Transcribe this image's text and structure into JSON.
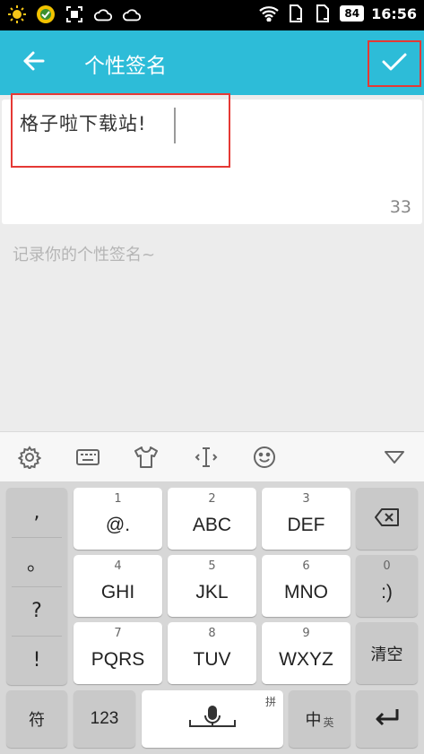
{
  "status_bar": {
    "battery": "84",
    "time": "16:56"
  },
  "header": {
    "title": "个性签名"
  },
  "editor": {
    "text": "格子啦下载站!",
    "counter": "33",
    "hint": "记录你的个性签名~"
  },
  "keyboard": {
    "punct": [
      ",",
      "。",
      "?",
      "!"
    ],
    "keys": {
      "k1": {
        "num": "1",
        "label": "@."
      },
      "k2": {
        "num": "2",
        "label": "ABC"
      },
      "k3": {
        "num": "3",
        "label": "DEF"
      },
      "k4": {
        "num": "4",
        "label": "GHI"
      },
      "k5": {
        "num": "5",
        "label": "JKL"
      },
      "k6": {
        "num": "6",
        "label": "MNO"
      },
      "k7": {
        "num": "7",
        "label": "PQRS"
      },
      "k8": {
        "num": "8",
        "label": "TUV"
      },
      "k9": {
        "num": "9",
        "label": "WXYZ"
      },
      "k0": {
        "num": "0",
        "label": ":)"
      }
    },
    "clear_label": "清空",
    "symbols_label": "符",
    "numbers_label": "123",
    "space_tag": "拼",
    "lang_label": "中",
    "lang_sub": "英"
  },
  "colors": {
    "accent": "#2dbcd8",
    "highlight": "#e53935"
  }
}
